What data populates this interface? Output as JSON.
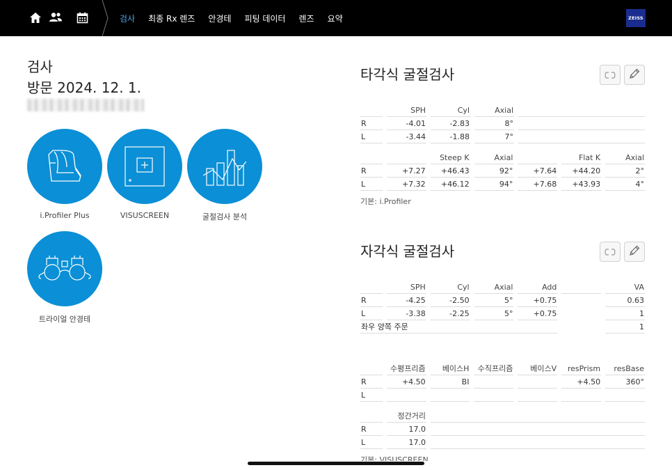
{
  "nav": {
    "tabs": [
      {
        "label": "검사",
        "active": true
      },
      {
        "label": "최종 Rx 렌즈",
        "active": false
      },
      {
        "label": "안경테",
        "active": false
      },
      {
        "label": "피팅 데이터",
        "active": false
      },
      {
        "label": "렌즈",
        "active": false
      },
      {
        "label": "요약",
        "active": false
      }
    ],
    "icons": [
      "home-icon",
      "users-icon",
      "calendar-icon"
    ],
    "brand": "ZEISS",
    "active_color": "#4ea3e0"
  },
  "left": {
    "title": "검사",
    "visit": "방문 2024. 12. 1.",
    "tiles": [
      {
        "label": "i.Profiler Plus",
        "icon": "iprofiler-icon"
      },
      {
        "label": "VISUSCREEN",
        "icon": "visuscreen-icon"
      },
      {
        "label": "굴절검사 분석",
        "icon": "chart-icon"
      },
      {
        "label": "트라이얼 안경테",
        "icon": "trial-frame-icon"
      }
    ],
    "tile_color": "#0b8fd6"
  },
  "objective": {
    "title": "타각식 굴절검사",
    "table1": {
      "headers": [
        "SPH",
        "Cyl",
        "Axial"
      ],
      "rows": [
        {
          "eye": "R",
          "sph": "-4.01",
          "cyl": "-2.83",
          "axial": "8°"
        },
        {
          "eye": "L",
          "sph": "-3.44",
          "cyl": "-1.88",
          "axial": "7°"
        }
      ]
    },
    "table2": {
      "headers": [
        "",
        "Steep K",
        "Axial",
        "",
        "Flat K",
        "Axial"
      ],
      "rows": [
        {
          "eye": "R",
          "c1": "+7.27",
          "c2": "+46.43",
          "c3": "92°",
          "c4": "+7.64",
          "c5": "+44.20",
          "c6": "2°"
        },
        {
          "eye": "L",
          "c1": "+7.32",
          "c2": "+46.12",
          "c3": "94°",
          "c4": "+7.68",
          "c5": "+43.93",
          "c6": "4°"
        }
      ]
    },
    "source": "기본: i.Profiler"
  },
  "subjective": {
    "title": "자각식 굴절검사",
    "table1": {
      "headers": [
        "SPH",
        "Cyl",
        "Axial",
        "Add",
        "",
        "VA"
      ],
      "rows": [
        {
          "eye": "R",
          "sph": "-4.25",
          "cyl": "-2.50",
          "axial": "5°",
          "add": "+0.75",
          "va": "0.63"
        },
        {
          "eye": "L",
          "sph": "-3.38",
          "cyl": "-2.25",
          "axial": "5°",
          "add": "+0.75",
          "va": "1"
        }
      ],
      "binocular_label": "좌우 양쪽 주문",
      "binocular_va": "1"
    },
    "table2": {
      "headers": [
        "수평프리즘",
        "베이스H",
        "수직프리즘",
        "베이스V",
        "resPrism",
        "resBase"
      ],
      "rows": [
        {
          "eye": "R",
          "c1": "+4.50",
          "c2": "BI",
          "c3": "",
          "c4": "",
          "c5": "+4.50",
          "c6": "360°"
        },
        {
          "eye": "L",
          "c1": "",
          "c2": "",
          "c3": "",
          "c4": "",
          "c5": "",
          "c6": ""
        }
      ]
    },
    "table3": {
      "header": "정간거리",
      "rows": [
        {
          "eye": "R",
          "value": "17.0"
        },
        {
          "eye": "L",
          "value": "17.0"
        }
      ]
    },
    "source": "기본: VISUSCREEN"
  }
}
